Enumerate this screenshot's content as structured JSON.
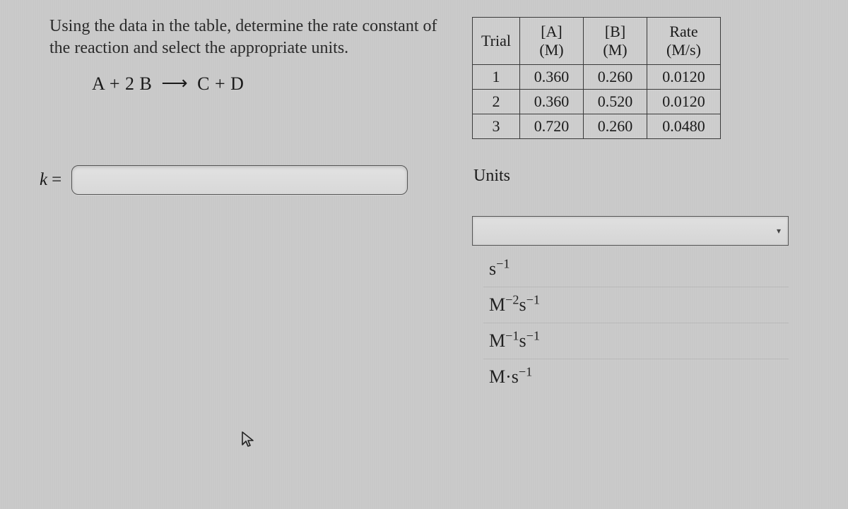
{
  "prompt": "Using the data in the table, determine the rate constant of the reaction and select the appropriate units.",
  "equation": {
    "left": "A + 2 B",
    "arrow": "⟶",
    "right": "C + D"
  },
  "table": {
    "headers": {
      "trial": "Trial",
      "a": "[A] (M)",
      "b": "[B] (M)",
      "rate": "Rate (M/s)"
    },
    "rows": [
      {
        "trial": "1",
        "a": "0.360",
        "b": "0.260",
        "rate": "0.0120"
      },
      {
        "trial": "2",
        "a": "0.360",
        "b": "0.520",
        "rate": "0.0120"
      },
      {
        "trial": "3",
        "a": "0.720",
        "b": "0.260",
        "rate": "0.0480"
      }
    ]
  },
  "k": {
    "label": "k",
    "eq": "=",
    "value": ""
  },
  "units": {
    "label": "Units",
    "selected": "",
    "options": [
      {
        "html": "s<sup>−1</sup>"
      },
      {
        "html": "M<sup>−2</sup>s<sup>−1</sup>"
      },
      {
        "html": "M<sup>−1</sup>s<sup>−1</sup>"
      },
      {
        "html": "M·s<sup>−1</sup>"
      }
    ]
  }
}
